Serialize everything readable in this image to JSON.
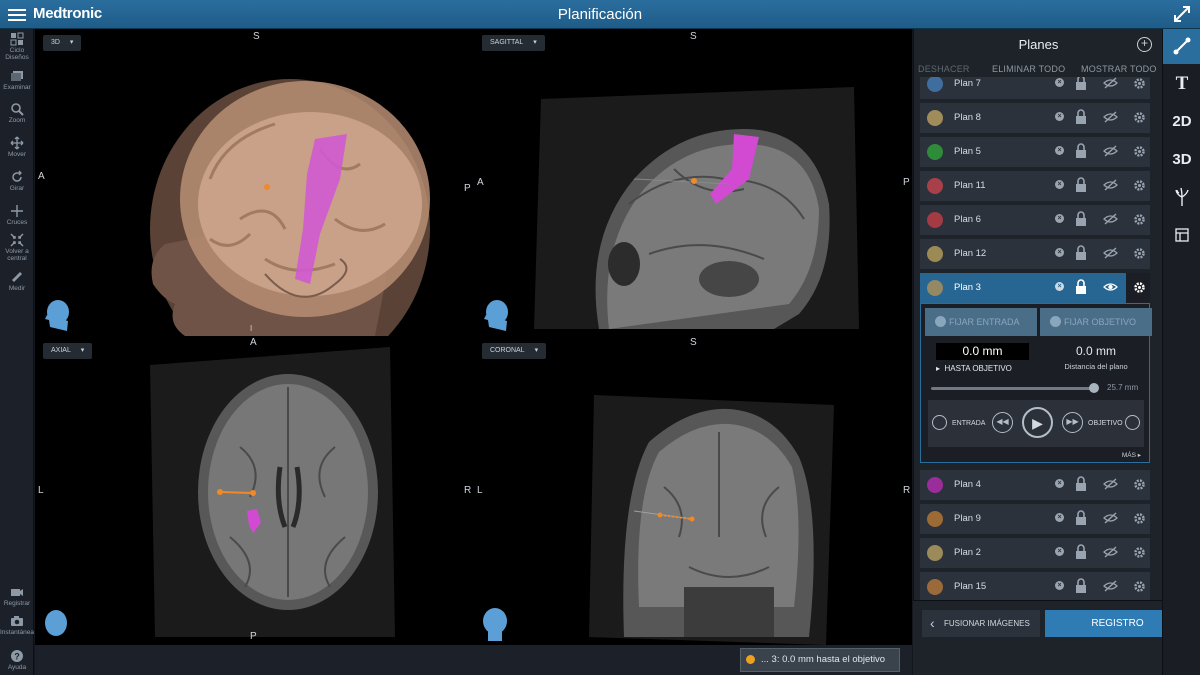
{
  "app": {
    "brand": "Medtronic",
    "title": "Planificación"
  },
  "toolbar": [
    {
      "label": "Ciclo Diseños",
      "icon": "layout-cycle-icon"
    },
    {
      "label": "Examinar",
      "icon": "examine-icon"
    },
    {
      "label": "Zoom",
      "icon": "zoom-icon"
    },
    {
      "label": "Mover",
      "icon": "move-icon"
    },
    {
      "label": "Girar",
      "icon": "rotate-icon"
    },
    {
      "label": "Cruces",
      "icon": "crosshair-icon"
    },
    {
      "label": "Volver a central",
      "icon": "recenter-icon"
    },
    {
      "label": "Medir",
      "icon": "ruler-icon"
    }
  ],
  "toolbar_bottom": [
    {
      "label": "Registrar",
      "icon": "record-icon"
    },
    {
      "label": "Instantánea",
      "icon": "camera-icon"
    },
    {
      "label": "Ayuda",
      "icon": "help-icon"
    }
  ],
  "viewports": {
    "v3d": {
      "label": "3D",
      "top": "S",
      "left": "A",
      "right": "P",
      "bottom": "I"
    },
    "sagittal": {
      "label": "SAGITTAL",
      "top": "S",
      "left": "A",
      "right": "P"
    },
    "axial": {
      "label": "AXIAL",
      "top": "A",
      "left": "L",
      "right": "R",
      "bottom": "P"
    },
    "coronal": {
      "label": "CORONAL",
      "top": "S",
      "left": "L",
      "right": "R"
    }
  },
  "panel": {
    "title": "Planes",
    "actions": {
      "undo": "DESHACER",
      "delete_all": "ELIMINAR TODO",
      "show_all": "MOSTRAR TODO"
    },
    "plans_before": [
      {
        "name": "Plan 7",
        "color": "#3f6e9e"
      },
      {
        "name": "Plan 8",
        "color": "#a08c5a"
      },
      {
        "name": "Plan 5",
        "color": "#2e8b3a"
      },
      {
        "name": "Plan 11",
        "color": "#a8404a"
      },
      {
        "name": "Plan 6",
        "color": "#a33a44"
      },
      {
        "name": "Plan 12",
        "color": "#9c8a55"
      }
    ],
    "active_plan": {
      "name": "Plan 3",
      "color": "#958864"
    },
    "plans_after": [
      {
        "name": "Plan 4",
        "color": "#9a2d9a"
      },
      {
        "name": "Plan 9",
        "color": "#9b6a35"
      },
      {
        "name": "Plan 2",
        "color": "#9b8a5a"
      },
      {
        "name": "Plan 15",
        "color": "#9b6a3a"
      }
    ],
    "detail": {
      "set_entry": "FIJAR ENTRADA",
      "set_target": "FIJAR OBJETIVO",
      "distance": "0.0 mm",
      "distance_label": "HASTA OBJETIVO",
      "plane_distance": "0.0 mm",
      "plane_distance_label": "Distancia del plano",
      "slider_value": "25.7 mm",
      "entry_label": "ENTRADA",
      "target_label": "OBJETIVO",
      "more": "MÁS"
    }
  },
  "footer": {
    "status": "... 3: 0.0 mm hasta el objetivo",
    "fuse_button": "FUSIONAR IMÁGENES",
    "register_button": "REGISTRO"
  },
  "right_strip": {
    "text_tool": "T",
    "view_2d": "2D",
    "view_3d": "3D"
  }
}
